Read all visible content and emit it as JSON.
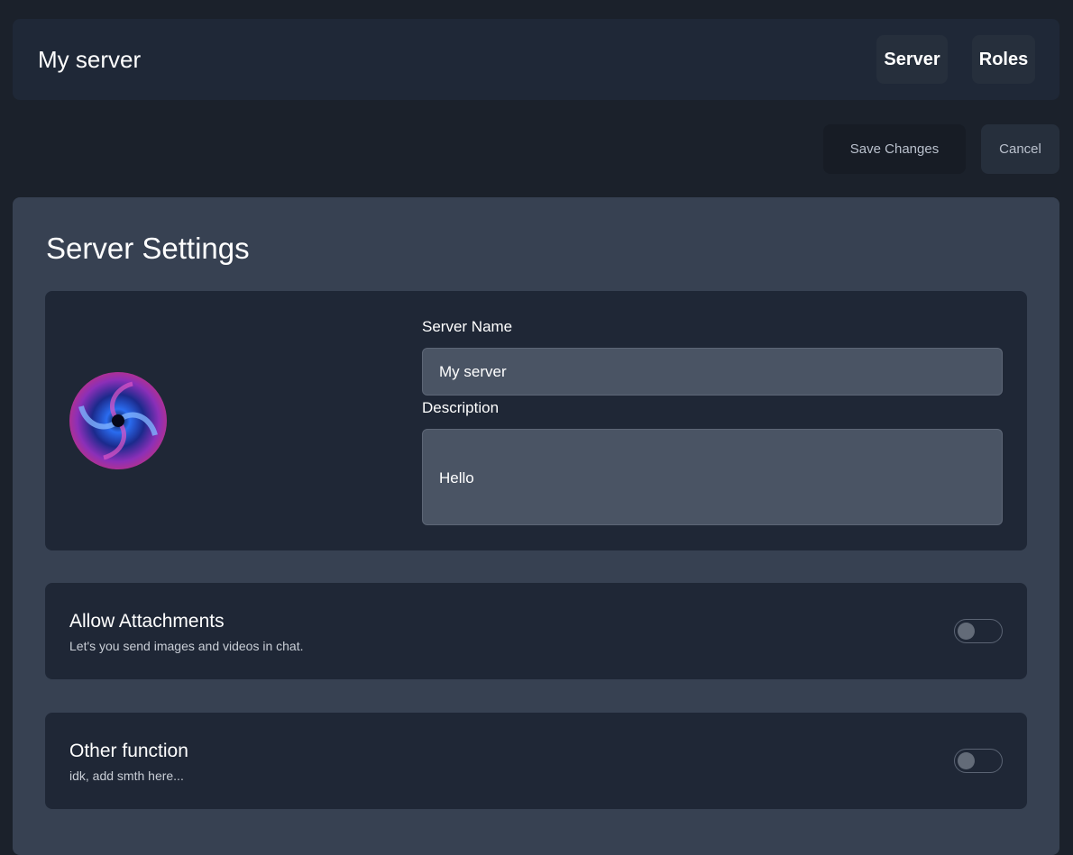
{
  "header": {
    "title": "My server",
    "nav": {
      "server_label": "Server",
      "roles_label": "Roles"
    }
  },
  "actions": {
    "save_label": "Save Changes",
    "cancel_label": "Cancel"
  },
  "settings": {
    "title": "Server Settings",
    "server_name": {
      "label": "Server Name",
      "value": "My server"
    },
    "description": {
      "label": "Description",
      "value": "Hello"
    },
    "options": [
      {
        "title": "Allow Attachments",
        "subtitle": "Let's you send images and videos in chat.",
        "enabled": false
      },
      {
        "title": "Other function",
        "subtitle": "idk, add smth here...",
        "enabled": false
      }
    ]
  },
  "colors": {
    "background": "#1b212b",
    "header": "#1f2837",
    "panel": "#374152",
    "card": "#1f2736",
    "input": "#4a5464"
  },
  "icons": {
    "avatar": "galaxy-swirl-server-avatar"
  }
}
